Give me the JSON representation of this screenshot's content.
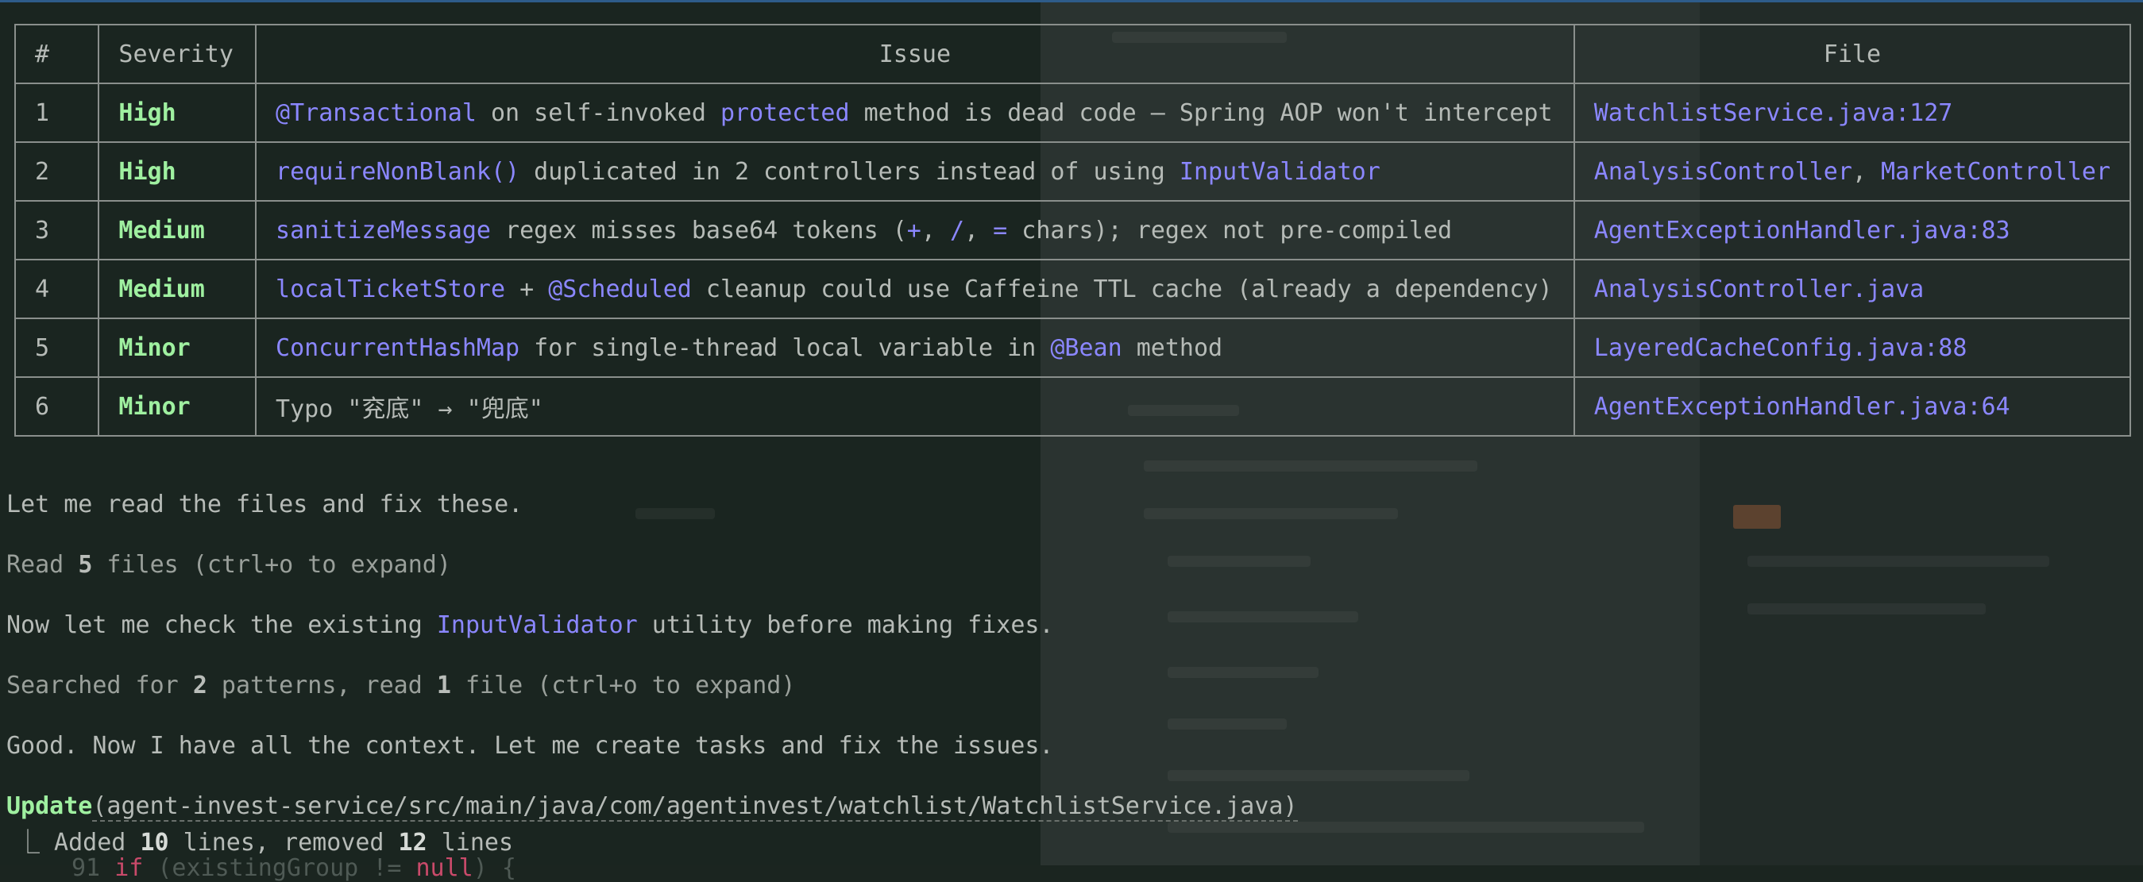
{
  "table": {
    "headers": {
      "num": "#",
      "severity": "Severity",
      "issue": "Issue",
      "file": "File"
    },
    "rows": [
      {
        "num": "1",
        "severity": "High",
        "issue": [
          {
            "t": "@Transactional",
            "c": "code"
          },
          {
            "t": " on self-invoked ",
            "c": "plain"
          },
          {
            "t": "protected",
            "c": "code"
          },
          {
            "t": " method is dead code — Spring AOP won't intercept",
            "c": "plain"
          }
        ],
        "file": [
          {
            "t": "WatchlistService.java:127",
            "c": "file"
          }
        ]
      },
      {
        "num": "2",
        "severity": "High",
        "issue": [
          {
            "t": "requireNonBlank()",
            "c": "code"
          },
          {
            "t": " duplicated in 2 controllers instead of using ",
            "c": "plain"
          },
          {
            "t": "InputValidator",
            "c": "code"
          }
        ],
        "file": [
          {
            "t": "AnalysisController",
            "c": "file"
          },
          {
            "t": ", ",
            "c": "plain"
          },
          {
            "t": "MarketController",
            "c": "file"
          }
        ]
      },
      {
        "num": "3",
        "severity": "Medium",
        "issue": [
          {
            "t": "sanitizeMessage",
            "c": "code"
          },
          {
            "t": " regex misses base64 tokens (",
            "c": "plain"
          },
          {
            "t": "+",
            "c": "code"
          },
          {
            "t": ", ",
            "c": "plain"
          },
          {
            "t": "/",
            "c": "code"
          },
          {
            "t": ", ",
            "c": "plain"
          },
          {
            "t": "=",
            "c": "code"
          },
          {
            "t": " chars); regex not pre-compiled",
            "c": "plain"
          }
        ],
        "file": [
          {
            "t": "AgentExceptionHandler.java:83",
            "c": "file"
          }
        ]
      },
      {
        "num": "4",
        "severity": "Medium",
        "issue": [
          {
            "t": "localTicketStore",
            "c": "code"
          },
          {
            "t": " + ",
            "c": "plain"
          },
          {
            "t": "@Scheduled",
            "c": "code"
          },
          {
            "t": " cleanup could use Caffeine TTL cache (already a dependency)",
            "c": "plain"
          }
        ],
        "file": [
          {
            "t": "AnalysisController.java",
            "c": "file"
          }
        ]
      },
      {
        "num": "5",
        "severity": "Minor",
        "issue": [
          {
            "t": "ConcurrentHashMap",
            "c": "code"
          },
          {
            "t": " for single-thread local variable in ",
            "c": "plain"
          },
          {
            "t": "@Bean",
            "c": "code"
          },
          {
            "t": " method",
            "c": "plain"
          }
        ],
        "file": [
          {
            "t": "LayeredCacheConfig.java:88",
            "c": "file"
          }
        ]
      },
      {
        "num": "6",
        "severity": "Minor",
        "issue": [
          {
            "t": "Typo \"兖底\" → \"兜底\"",
            "c": "plain"
          }
        ],
        "file": [
          {
            "t": "AgentExceptionHandler.java:64",
            "c": "file"
          }
        ]
      }
    ]
  },
  "messages": {
    "m1": "Let me read the files and fix these.",
    "m2_prefix": "Read ",
    "m2_count": "5",
    "m2_suffix": " files (ctrl+o to expand)",
    "m3_prefix": "Now let me check the existing ",
    "m3_code": "InputValidator",
    "m3_suffix": " utility before making fixes.",
    "m4_prefix": "Searched for ",
    "m4_count1": "2",
    "m4_mid": " patterns, read ",
    "m4_count2": "1",
    "m4_suffix": " file (ctrl+o to expand)",
    "m5": "Good. Now I have all the context. Let me create tasks and fix the issues.",
    "update_tool": "Update",
    "update_path": "(agent-invest-service/src/main/java/com/agentinvest/watchlist/WatchlistService.java)",
    "sub_prefix": "⎿ Added ",
    "sub_added": "10",
    "sub_mid": " lines, removed ",
    "sub_removed": "12",
    "sub_suffix": " lines",
    "cut_num": "91",
    "cut_kw1": "if",
    "cut_mid": " (existingGroup != ",
    "cut_kw2": "null",
    "cut_end": ") {"
  },
  "colors": {
    "severity": "#9ff0a0",
    "code": "#8b87ff",
    "text": "#b6bbb7",
    "border": "#8a8f8c"
  }
}
